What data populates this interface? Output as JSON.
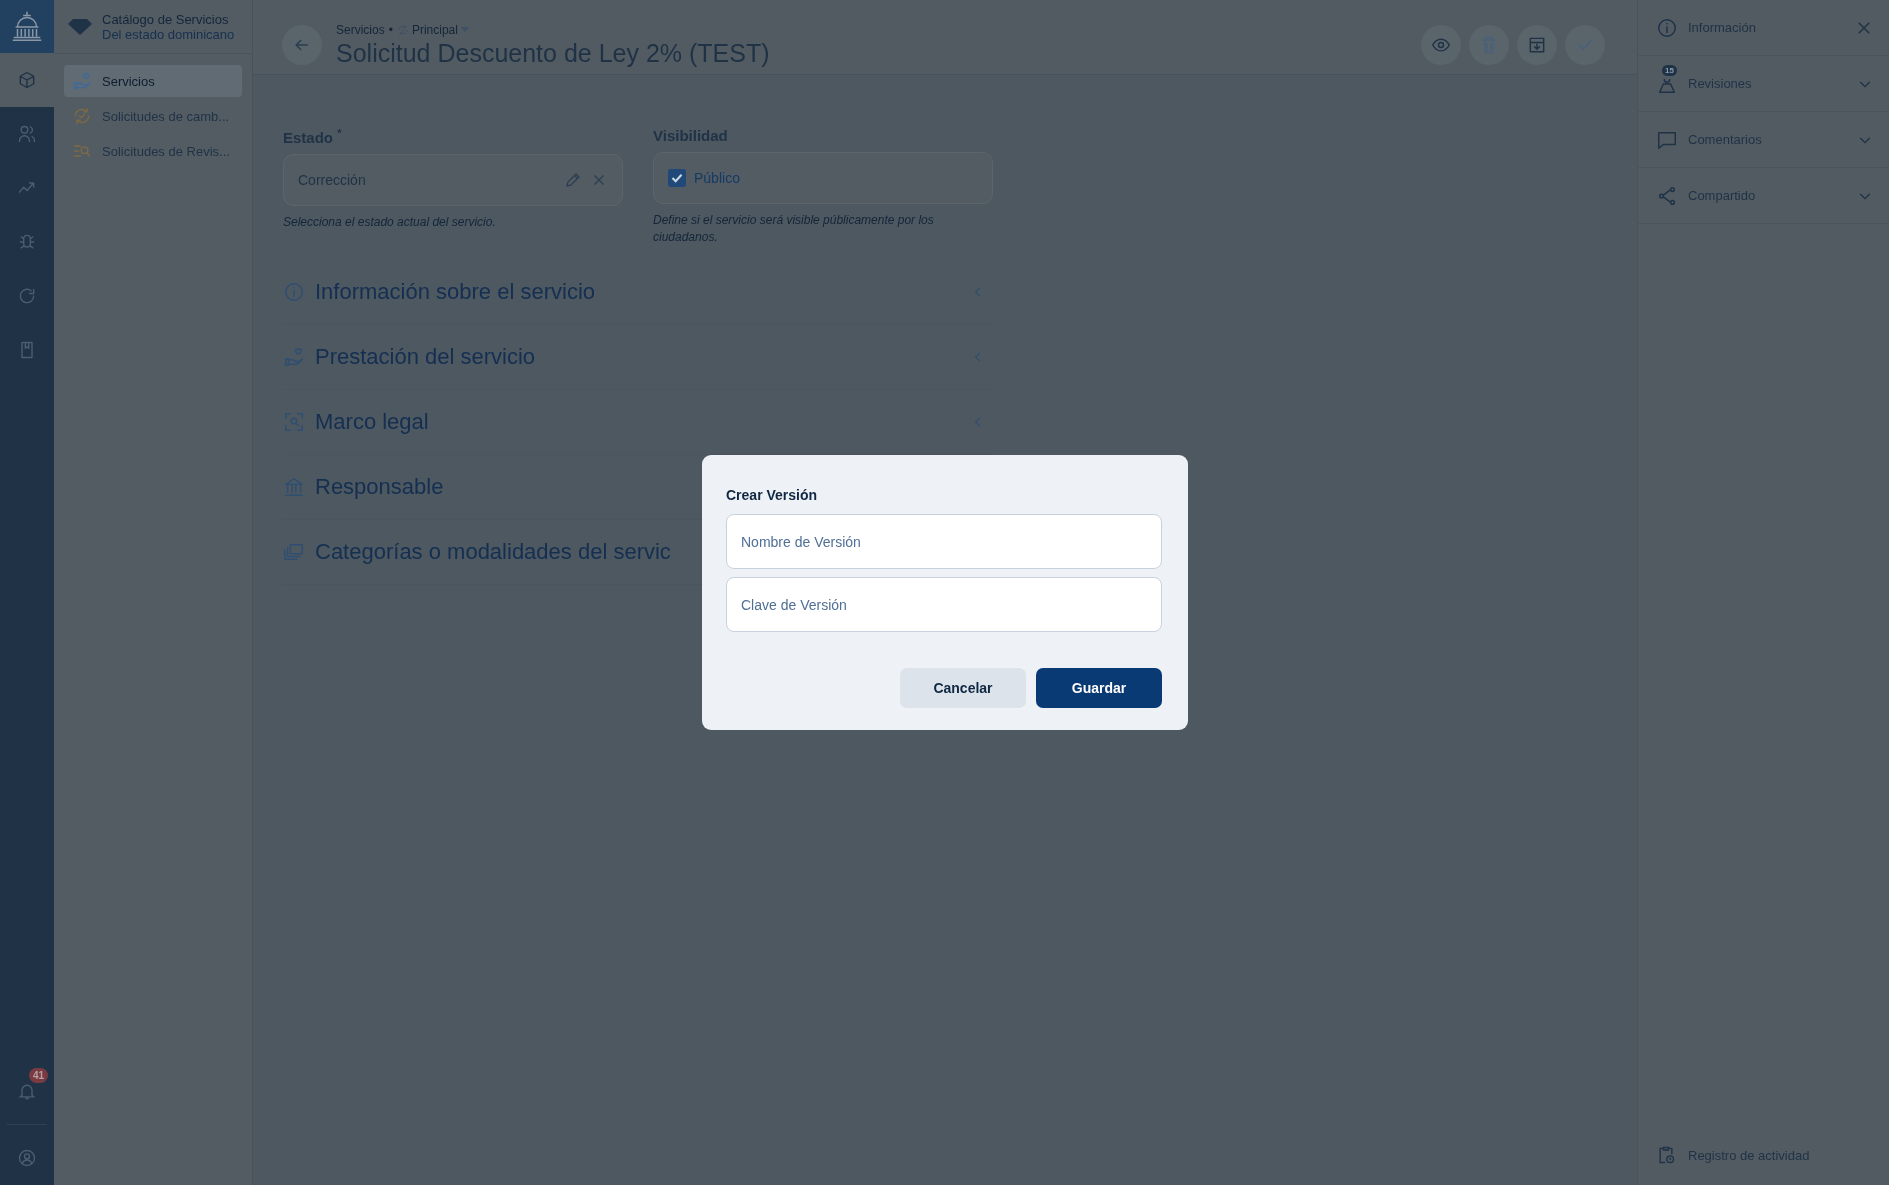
{
  "brand": {
    "title": "Catálogo de Servicios",
    "subtitle": "Del estado dominicano"
  },
  "rail": [
    {
      "kind": "cube",
      "selected": true
    },
    {
      "kind": "users",
      "selected": false
    },
    {
      "kind": "chart",
      "selected": false
    },
    {
      "kind": "bug",
      "selected": false
    },
    {
      "kind": "refresh",
      "selected": false
    },
    {
      "kind": "book",
      "selected": false
    }
  ],
  "notifications": {
    "count": "41"
  },
  "sidebar": {
    "items": [
      {
        "label": "Servicios",
        "kind": "hand-heart",
        "selected": true
      },
      {
        "label": "Solicitudes de camb...",
        "kind": "cycle",
        "selected": false
      },
      {
        "label": "Solicitudes de Revis...",
        "kind": "list-search",
        "selected": false
      }
    ]
  },
  "header": {
    "breadcrumb": "Servicios",
    "separator": "•",
    "branch": "Principal",
    "title": "Solicitud Descuento de Ley 2% (TEST)",
    "actions": [
      {
        "kind": "eye",
        "disabled": false
      },
      {
        "kind": "trash",
        "disabled": true
      },
      {
        "kind": "archive",
        "disabled": false
      },
      {
        "kind": "check",
        "disabled": true
      }
    ]
  },
  "form": {
    "estado": {
      "label": "Estado",
      "required_mark": "*",
      "value": "Corrección",
      "help": "Selecciona el estado actual del servicio."
    },
    "visibilidad": {
      "label": "Visibilidad",
      "option": "Público",
      "checked": true,
      "help": "Define si el servicio será visible públicamente por los ciudadanos."
    }
  },
  "sections": [
    {
      "title": "Información sobre el servicio",
      "kind": "info",
      "chevron": true
    },
    {
      "title": "Prestación del servicio",
      "kind": "hand-heart",
      "chevron": true
    },
    {
      "title": "Marco legal",
      "kind": "scan",
      "chevron": true
    },
    {
      "title": "Responsable",
      "kind": "bank",
      "chevron": false
    },
    {
      "title": "Categorías o modalidades del servic",
      "kind": "layers",
      "chevron": false
    }
  ],
  "panel": {
    "items": [
      {
        "label": "Información",
        "kind": "info",
        "closable": true
      },
      {
        "label": "Revisiones",
        "kind": "revisions",
        "badge": "15",
        "closable": false,
        "expanded": false
      },
      {
        "label": "Comentarios",
        "kind": "comment",
        "closable": false,
        "expanded": false
      },
      {
        "label": "Compartido",
        "kind": "share",
        "closable": false,
        "expanded": false
      }
    ],
    "footer": "Registro de actividad"
  },
  "dialog": {
    "title": "Crear Versión",
    "fields": [
      {
        "placeholder": "Nombre de Versión"
      },
      {
        "placeholder": "Clave de Versión"
      }
    ],
    "buttons": [
      {
        "label": "Cancelar",
        "kind": "secondary"
      },
      {
        "label": "Guardar",
        "kind": "primary"
      }
    ]
  }
}
